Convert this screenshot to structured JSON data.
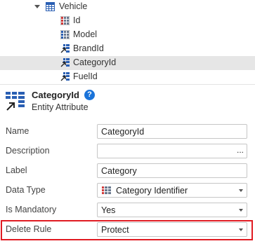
{
  "tree": {
    "entity": {
      "label": "Vehicle"
    },
    "attributes": [
      {
        "label": "Id",
        "icon": "id-attribute-icon"
      },
      {
        "label": "Model",
        "icon": "attribute-icon"
      },
      {
        "label": "BrandId",
        "icon": "reference-attribute-icon"
      },
      {
        "label": "CategoryId",
        "icon": "reference-attribute-icon",
        "selected": true
      },
      {
        "label": "FuelId",
        "icon": "reference-attribute-icon"
      }
    ]
  },
  "header": {
    "title": "CategoryId",
    "subtitle": "Entity Attribute",
    "help": "?"
  },
  "properties": {
    "name": {
      "label": "Name",
      "value": "CategoryId"
    },
    "description": {
      "label": "Description",
      "value": "",
      "button": "..."
    },
    "label": {
      "label": "Label",
      "value": "Category"
    },
    "data_type": {
      "label": "Data Type",
      "value": "Category Identifier"
    },
    "is_mandatory": {
      "label": "Is Mandatory",
      "value": "Yes"
    },
    "delete_rule": {
      "label": "Delete Rule",
      "value": "Protect"
    }
  },
  "colors": {
    "highlight": "#e01b22",
    "selected_row": "#e6e6e6",
    "help_badge": "#1a73d9",
    "entity_icon": "#2a5fb3"
  }
}
